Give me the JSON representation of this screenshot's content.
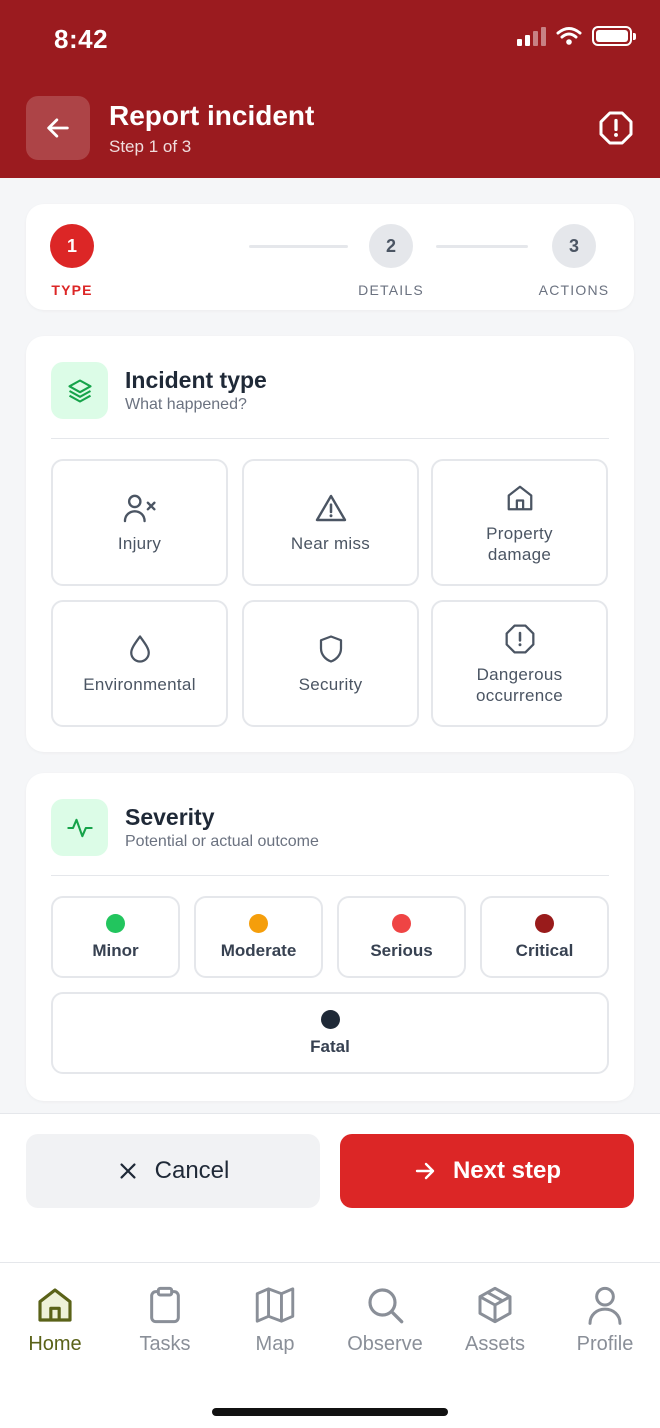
{
  "status": {
    "time": "8:42"
  },
  "header": {
    "title": "Report incident",
    "subtitle": "Step 1 of 3"
  },
  "stepper": {
    "steps": [
      {
        "number": "1",
        "label": "TYPE"
      },
      {
        "number": "2",
        "label": "DETAILS"
      },
      {
        "number": "3",
        "label": "ACTIONS"
      }
    ],
    "active": 1
  },
  "incident": {
    "title": "Incident type",
    "subtitle": "What happened?",
    "types": [
      {
        "label": "Injury",
        "icon": "user-x-icon"
      },
      {
        "label": "Near miss",
        "icon": "warning-triangle-icon"
      },
      {
        "label": "Property damage",
        "icon": "house-icon"
      },
      {
        "label": "Environmental",
        "icon": "droplet-icon"
      },
      {
        "label": "Security",
        "icon": "shield-icon"
      },
      {
        "label": "Dangerous occurrence",
        "icon": "alert-octagon-icon"
      }
    ]
  },
  "severity": {
    "title": "Severity",
    "subtitle": "Potential or actual outcome",
    "levels": [
      {
        "label": "Minor",
        "color": "#22c55e"
      },
      {
        "label": "Moderate",
        "color": "#f59e0b"
      },
      {
        "label": "Serious",
        "color": "#ef4444"
      },
      {
        "label": "Critical",
        "color": "#991b1b"
      },
      {
        "label": "Fatal",
        "color": "#1f2937"
      }
    ]
  },
  "actions": {
    "cancel": "Cancel",
    "next": "Next step"
  },
  "tabs": [
    {
      "label": "Home",
      "icon": "home-icon"
    },
    {
      "label": "Tasks",
      "icon": "clipboard-icon"
    },
    {
      "label": "Map",
      "icon": "map-icon"
    },
    {
      "label": "Observe",
      "icon": "search-icon"
    },
    {
      "label": "Assets",
      "icon": "box-icon"
    },
    {
      "label": "Profile",
      "icon": "user-icon"
    }
  ],
  "colors": {
    "header": "#9b1b1f",
    "accent": "#dc2626",
    "active_tab": "#5a6218",
    "section_icon_bg": "#dcfce7"
  }
}
